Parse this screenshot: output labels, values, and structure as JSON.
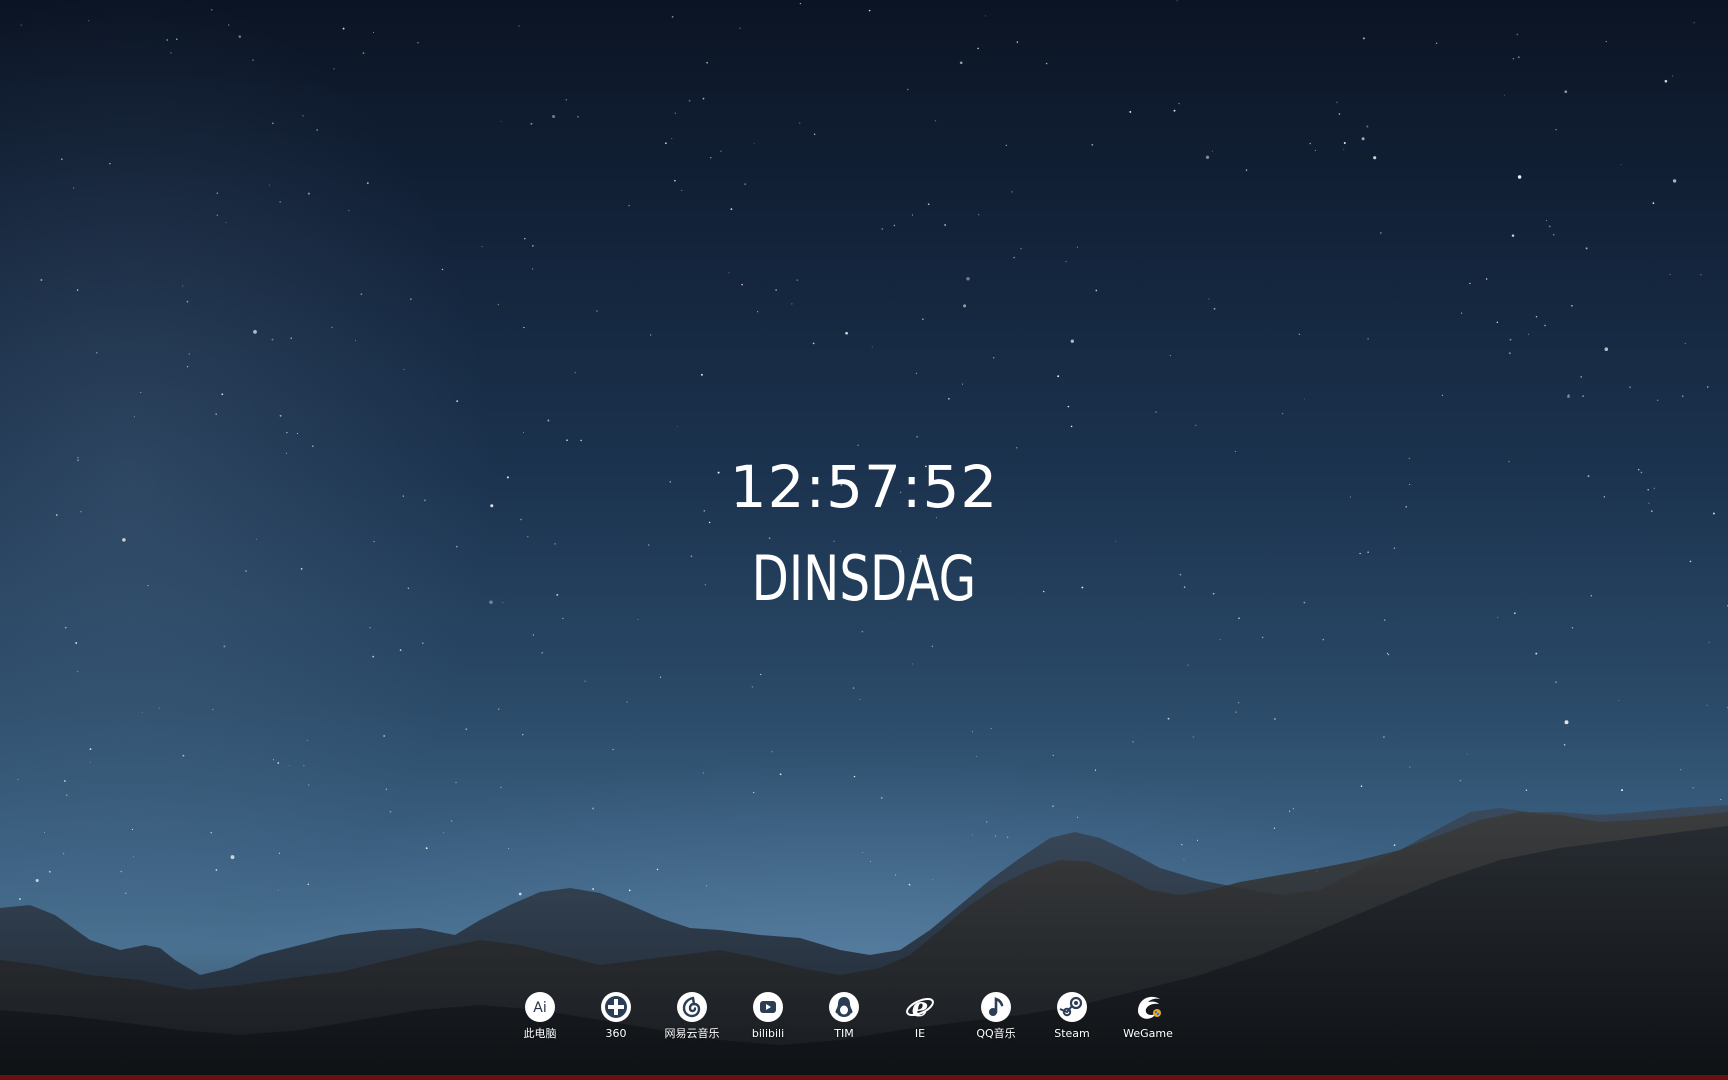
{
  "clock": {
    "time": "12:57:52",
    "day": "DINSDAG"
  },
  "dock": {
    "items": [
      {
        "label": "此电脑",
        "icon": "ai-icon"
      },
      {
        "label": "360",
        "icon": "360-plus-icon"
      },
      {
        "label": "网易云音乐",
        "icon": "netease-music-icon"
      },
      {
        "label": "bilibili",
        "icon": "bilibili-play-icon"
      },
      {
        "label": "TIM",
        "icon": "tim-penguin-icon"
      },
      {
        "label": "IE",
        "icon": "ie-icon"
      },
      {
        "label": "QQ音乐",
        "icon": "qq-music-icon"
      },
      {
        "label": "Steam",
        "icon": "steam-icon"
      },
      {
        "label": "WeGame",
        "icon": "wegame-icon"
      }
    ]
  },
  "colors": {
    "text": "#ffffff",
    "sky_top": "#0b1424",
    "sky_horizon": "#4a7191",
    "mountain": "#1e2630"
  }
}
